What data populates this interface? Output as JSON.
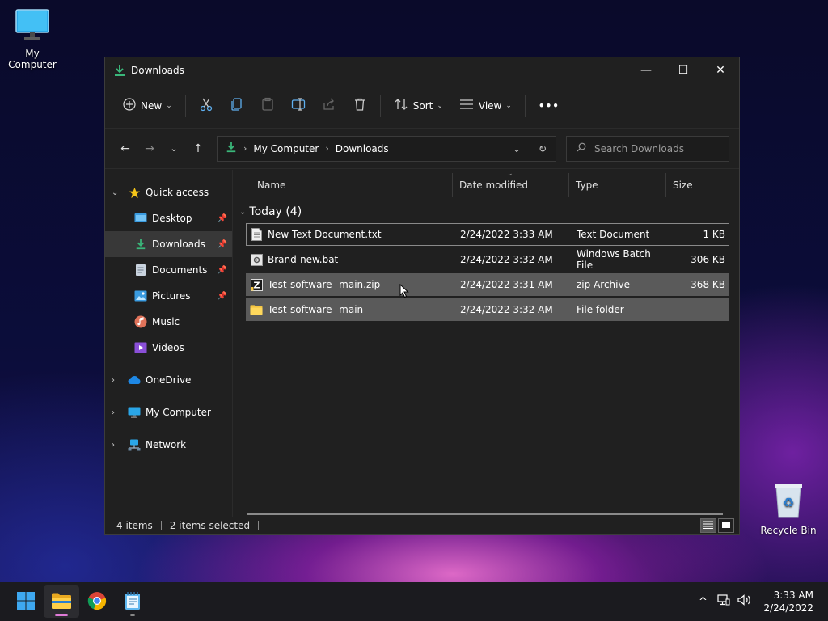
{
  "desktop": {
    "my_computer_label": "My Computer",
    "recycle_bin_label": "Recycle Bin"
  },
  "window": {
    "title": "Downloads",
    "controls": {
      "minimize": "—",
      "maximize": "☐",
      "close": "✕"
    }
  },
  "toolbar": {
    "new_label": "New",
    "sort_label": "Sort",
    "view_label": "View",
    "more_label": "•••",
    "icons": [
      "cut-icon",
      "copy-icon",
      "paste-icon",
      "rename-icon",
      "share-icon",
      "delete-icon"
    ]
  },
  "navbar": {
    "breadcrumb": [
      "My Computer",
      "Downloads"
    ],
    "search_placeholder": "Search Downloads"
  },
  "sidebar": {
    "quick_access": "Quick access",
    "items": [
      {
        "label": "Desktop",
        "pinned": true
      },
      {
        "label": "Downloads",
        "pinned": true,
        "selected": true
      },
      {
        "label": "Documents",
        "pinned": true
      },
      {
        "label": "Pictures",
        "pinned": true
      },
      {
        "label": "Music",
        "pinned": false
      },
      {
        "label": "Videos",
        "pinned": false
      }
    ],
    "onedrive": "OneDrive",
    "my_computer": "My Computer",
    "network": "Network"
  },
  "columns": {
    "name": "Name",
    "date": "Date modified",
    "type": "Type",
    "size": "Size"
  },
  "group": {
    "label": "Today (4)"
  },
  "files": [
    {
      "name": "New Text Document.txt",
      "date": "2/24/2022 3:33 AM",
      "type": "Text Document",
      "size": "1 KB",
      "icon": "text-file-icon"
    },
    {
      "name": "Brand-new.bat",
      "date": "2/24/2022 3:32 AM",
      "type": "Windows Batch File",
      "size": "306 KB",
      "icon": "batch-file-icon"
    },
    {
      "name": "Test-software--main.zip",
      "date": "2/24/2022 3:31 AM",
      "type": "zip Archive",
      "size": "368 KB",
      "icon": "zip-file-icon"
    },
    {
      "name": "Test-software--main",
      "date": "2/24/2022 3:32 AM",
      "type": "File folder",
      "size": "",
      "icon": "folder-icon"
    }
  ],
  "status": {
    "items": "4 items",
    "selected": "2 items selected"
  },
  "taskbar": {
    "time": "3:33 AM",
    "date": "2/24/2022"
  },
  "colors": {
    "accent_green": "#3ab77a",
    "folder_yellow": "#f4c542",
    "selection": "#5a5a5a"
  }
}
